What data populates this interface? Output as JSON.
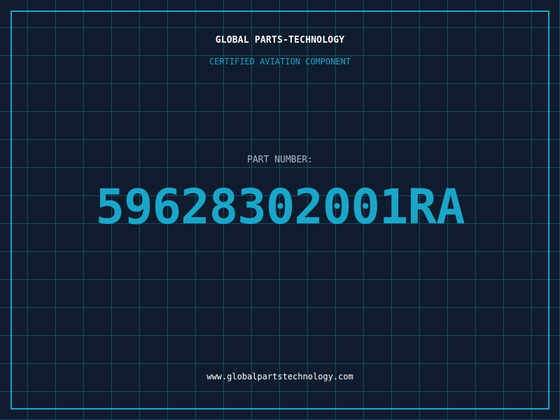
{
  "header": {
    "brand": "GLOBAL PARTS-TECHNOLOGY",
    "subtitle": "CERTIFIED AVIATION COMPONENT"
  },
  "part": {
    "label": "PART NUMBER:",
    "number": "59628302001RA"
  },
  "footer": {
    "website": "www.globalpartstechnology.com"
  },
  "colors": {
    "background": "#0f1c2e",
    "accent": "#1aa6c9",
    "grid": "#167696",
    "text": "#ffffff",
    "muted": "#a9b8c8"
  }
}
